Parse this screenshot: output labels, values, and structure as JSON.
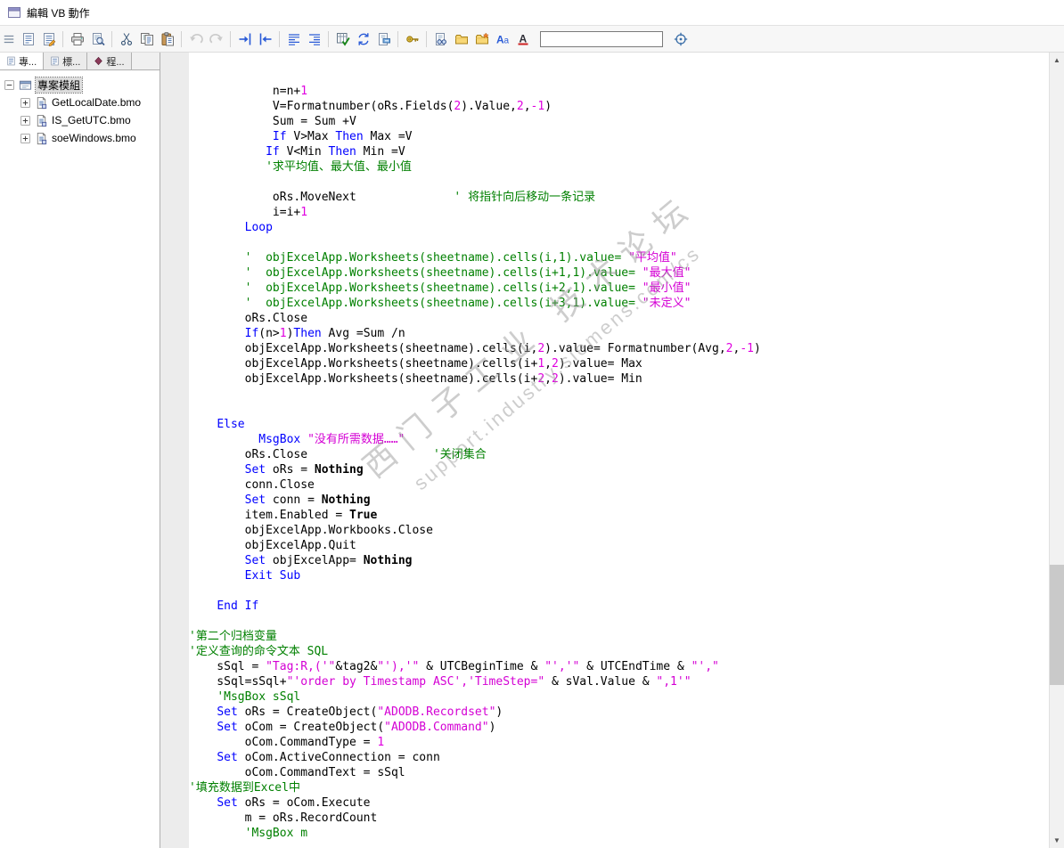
{
  "window": {
    "title": "編輯 VB 動作"
  },
  "toolbar": {
    "search": {
      "value": ""
    },
    "buttons": [
      {
        "name": "action-list",
        "symbol": "sheet"
      },
      {
        "name": "edit-action",
        "symbol": "sheet-edit"
      },
      {
        "sep": true
      },
      {
        "name": "print",
        "symbol": "print"
      },
      {
        "name": "print-preview",
        "symbol": "preview"
      },
      {
        "sep": true
      },
      {
        "name": "cut",
        "symbol": "cut"
      },
      {
        "name": "copy",
        "symbol": "copy"
      },
      {
        "name": "paste",
        "symbol": "paste"
      },
      {
        "sep": true
      },
      {
        "name": "undo",
        "symbol": "undo",
        "disabled": true
      },
      {
        "name": "redo",
        "symbol": "redo",
        "disabled": true
      },
      {
        "sep": true
      },
      {
        "name": "increase-indent",
        "symbol": "indent-right"
      },
      {
        "name": "decrease-indent",
        "symbol": "indent-left"
      },
      {
        "sep": true
      },
      {
        "name": "format-lines",
        "symbol": "lines-a"
      },
      {
        "name": "format-lines-alt",
        "symbol": "lines-b"
      },
      {
        "sep": true
      },
      {
        "name": "check-syntax",
        "symbol": "grid-check"
      },
      {
        "name": "synchronize",
        "symbol": "sync"
      },
      {
        "name": "bookmark",
        "symbol": "flag"
      },
      {
        "sep": true
      },
      {
        "name": "password-protect",
        "symbol": "key"
      },
      {
        "sep": true
      },
      {
        "name": "find-in-document",
        "symbol": "find-doc"
      },
      {
        "name": "open-folder",
        "symbol": "folder"
      },
      {
        "name": "import-file",
        "symbol": "folder-star"
      },
      {
        "name": "find-text",
        "symbol": "find-chars"
      },
      {
        "name": "font",
        "symbol": "font-a"
      },
      {
        "search": true
      },
      {
        "name": "goto-target",
        "symbol": "target"
      }
    ]
  },
  "sidebar": {
    "tabs": [
      {
        "name": "project-modules",
        "label": "專...",
        "icon": "sheet",
        "active": true
      },
      {
        "name": "standard-modules",
        "label": "標...",
        "icon": "sheet",
        "active": false
      },
      {
        "name": "actions",
        "label": "程...",
        "icon": "diamond",
        "active": false
      }
    ],
    "tree": {
      "root_label": "專案模組",
      "items": [
        {
          "label": "GetLocalDate.bmo"
        },
        {
          "label": "IS_GetUTC.bmo"
        },
        {
          "label": "soeWindows.bmo"
        }
      ]
    }
  },
  "editor": {
    "colors": {
      "text": "#000000",
      "keyword": "#0000ff",
      "comment": "#008000",
      "string": "#d400d4",
      "number": "#e000e0"
    },
    "watermark": {
      "line1": "西门子工业 技术论坛",
      "line2": "support.industry.siemens.com/cs"
    },
    "lines": [
      [],
      [],
      [
        [
          "t",
          "            n=n+"
        ],
        [
          "n",
          "1"
        ]
      ],
      [
        [
          "t",
          "            V=Formatnumber(oRs.Fields("
        ],
        [
          "n",
          "2"
        ],
        [
          "t",
          ").Value,"
        ],
        [
          "n",
          "2"
        ],
        [
          "t",
          ","
        ],
        [
          "n",
          "-1"
        ],
        [
          "t",
          ")"
        ]
      ],
      [
        [
          "t",
          "            Sum = Sum +V"
        ]
      ],
      [
        [
          "t",
          "            "
        ],
        [
          "k",
          "If"
        ],
        [
          "t",
          " V>Max "
        ],
        [
          "k",
          "Then"
        ],
        [
          "t",
          " Max =V"
        ]
      ],
      [
        [
          "t",
          "           "
        ],
        [
          "k",
          "If"
        ],
        [
          "t",
          " V<Min "
        ],
        [
          "k",
          "Then"
        ],
        [
          "t",
          " Min =V"
        ]
      ],
      [
        [
          "t",
          "           "
        ],
        [
          "c",
          "'求平均值、最大值、最小值"
        ]
      ],
      [],
      [
        [
          "t",
          "            oRs.MoveNext              "
        ],
        [
          "c",
          "' 将指针向后移动一条记录"
        ]
      ],
      [
        [
          "t",
          "            i=i+"
        ],
        [
          "n",
          "1"
        ]
      ],
      [
        [
          "t",
          "        "
        ],
        [
          "k",
          "Loop"
        ]
      ],
      [],
      [
        [
          "t",
          "        "
        ],
        [
          "c",
          "'  objExcelApp.Worksheets(sheetname).cells(i,1).value= "
        ],
        [
          "s",
          "\"平均值\""
        ]
      ],
      [
        [
          "t",
          "        "
        ],
        [
          "c",
          "'  objExcelApp.Worksheets(sheetname).cells(i+1,1).value= "
        ],
        [
          "s",
          "\"最大值\""
        ]
      ],
      [
        [
          "t",
          "        "
        ],
        [
          "c",
          "'  objExcelApp.Worksheets(sheetname).cells(i+2,1).value= "
        ],
        [
          "s",
          "\"最小值\""
        ]
      ],
      [
        [
          "t",
          "        "
        ],
        [
          "c",
          "'  objExcelApp.Worksheets(sheetname).cells(i+3,1).value= "
        ],
        [
          "s",
          "\"未定义\""
        ]
      ],
      [
        [
          "t",
          "        oRs.Close"
        ]
      ],
      [
        [
          "t",
          "        "
        ],
        [
          "k",
          "If"
        ],
        [
          "t",
          "(n>"
        ],
        [
          "n",
          "1"
        ],
        [
          "t",
          ")"
        ],
        [
          "k",
          "Then"
        ],
        [
          "t",
          " Avg =Sum /n"
        ]
      ],
      [
        [
          "t",
          "        objExcelApp.Worksheets(sheetname).cells(i,"
        ],
        [
          "n",
          "2"
        ],
        [
          "t",
          ").value= Formatnumber(Avg,"
        ],
        [
          "n",
          "2"
        ],
        [
          "t",
          ","
        ],
        [
          "n",
          "-1"
        ],
        [
          "t",
          ")"
        ]
      ],
      [
        [
          "t",
          "        objExcelApp.Worksheets(sheetname).cells(i+"
        ],
        [
          "n",
          "1"
        ],
        [
          "t",
          ","
        ],
        [
          "n",
          "2"
        ],
        [
          "t",
          ").value= Max"
        ]
      ],
      [
        [
          "t",
          "        objExcelApp.Worksheets(sheetname).cells(i+"
        ],
        [
          "n",
          "2"
        ],
        [
          "t",
          ","
        ],
        [
          "n",
          "2"
        ],
        [
          "t",
          ").value= Min"
        ]
      ],
      [],
      [],
      [
        [
          "t",
          "    "
        ],
        [
          "k",
          "Else"
        ]
      ],
      [
        [
          "t",
          "          "
        ],
        [
          "k",
          "MsgBox"
        ],
        [
          "t",
          " "
        ],
        [
          "s",
          "\"没有所需数据……\""
        ]
      ],
      [
        [
          "t",
          "        oRs.Close                  "
        ],
        [
          "c",
          "'关闭集合"
        ]
      ],
      [
        [
          "t",
          "        "
        ],
        [
          "k",
          "Set"
        ],
        [
          "t",
          " oRs = "
        ],
        [
          "b",
          "Nothing"
        ]
      ],
      [
        [
          "t",
          "        conn.Close"
        ]
      ],
      [
        [
          "t",
          "        "
        ],
        [
          "k",
          "Set"
        ],
        [
          "t",
          " conn = "
        ],
        [
          "b",
          "Nothing"
        ]
      ],
      [
        [
          "t",
          "        item.Enabled = "
        ],
        [
          "b",
          "True"
        ]
      ],
      [
        [
          "t",
          "        objExcelApp.Workbooks.Close"
        ]
      ],
      [
        [
          "t",
          "        objExcelApp.Quit"
        ]
      ],
      [
        [
          "t",
          "        "
        ],
        [
          "k",
          "Set"
        ],
        [
          "t",
          " objExcelApp= "
        ],
        [
          "b",
          "Nothing"
        ]
      ],
      [
        [
          "t",
          "        "
        ],
        [
          "k",
          "Exit Sub"
        ]
      ],
      [],
      [
        [
          "t",
          "    "
        ],
        [
          "k",
          "End If"
        ]
      ],
      [],
      [
        [
          "c",
          "'第二个归档变量"
        ]
      ],
      [
        [
          "c",
          "'定义查询的命令文本 SQL"
        ]
      ],
      [
        [
          "t",
          "    sSql = "
        ],
        [
          "s",
          "\"Tag:R,('\""
        ],
        [
          "t",
          "&tag2&"
        ],
        [
          "s",
          "\"'),'\""
        ],
        [
          "t",
          " & UTCBeginTime & "
        ],
        [
          "s",
          "\"','\""
        ],
        [
          "t",
          " & UTCEndTime & "
        ],
        [
          "s",
          "\"',\""
        ]
      ],
      [
        [
          "t",
          "    sSql=sSql+"
        ],
        [
          "s",
          "\"'order by Timestamp ASC','TimeStep=\""
        ],
        [
          "t",
          " & sVal.Value & "
        ],
        [
          "s",
          "\",1'\""
        ]
      ],
      [
        [
          "t",
          "    "
        ],
        [
          "c",
          "'MsgBox sSql"
        ]
      ],
      [
        [
          "t",
          "    "
        ],
        [
          "k",
          "Set"
        ],
        [
          "t",
          " oRs = CreateObject("
        ],
        [
          "s",
          "\"ADODB.Recordset\""
        ],
        [
          "t",
          ")"
        ]
      ],
      [
        [
          "t",
          "    "
        ],
        [
          "k",
          "Set"
        ],
        [
          "t",
          " oCom = CreateObject("
        ],
        [
          "s",
          "\"ADODB.Command\""
        ],
        [
          "t",
          ")"
        ]
      ],
      [
        [
          "t",
          "        oCom.CommandType = "
        ],
        [
          "n",
          "1"
        ]
      ],
      [
        [
          "t",
          "    "
        ],
        [
          "k",
          "Set"
        ],
        [
          "t",
          " oCom.ActiveConnection = conn"
        ]
      ],
      [
        [
          "t",
          "        oCom.CommandText = sSql"
        ]
      ],
      [
        [
          "c",
          "'填充数据到Excel中"
        ]
      ],
      [
        [
          "t",
          "    "
        ],
        [
          "k",
          "Set"
        ],
        [
          "t",
          " oRs = oCom.Execute"
        ]
      ],
      [
        [
          "t",
          "        m = oRs.RecordCount"
        ]
      ],
      [
        [
          "t",
          "        "
        ],
        [
          "c",
          "'MsgBox m"
        ]
      ]
    ]
  }
}
